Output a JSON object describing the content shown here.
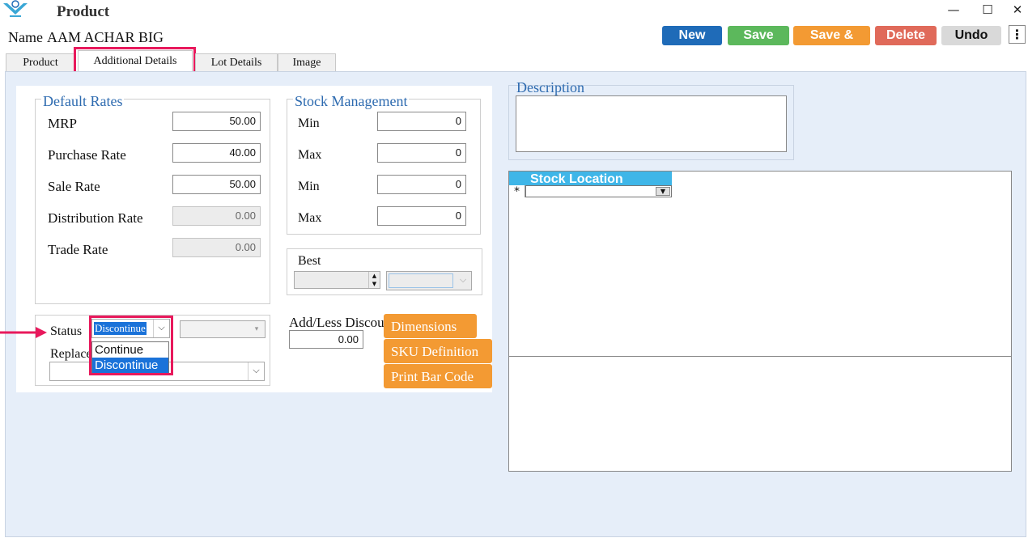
{
  "window": {
    "title": "Product",
    "minimize": "—",
    "maximize": "☐",
    "close": "✕"
  },
  "name": {
    "label": "Name",
    "value": "AAM ACHAR BIG"
  },
  "toolbar": {
    "new": "New",
    "save": "Save",
    "save_and": "Save &",
    "delete": "Delete",
    "undo": "Undo",
    "more": "⋮",
    "colors": {
      "new": "#1f6bb8",
      "save": "#5cb85c",
      "save_and": "#f39a33",
      "delete": "#e06a5a",
      "undo": "#d9d9d9"
    }
  },
  "tabs": [
    "Product",
    "Additional Details",
    "Lot Details",
    "Image"
  ],
  "default_rates": {
    "title": "Default Rates",
    "rows": [
      {
        "label": "MRP",
        "value": "50.00",
        "disabled": false
      },
      {
        "label": "Purchase Rate",
        "value": "40.00",
        "disabled": false
      },
      {
        "label": "Sale Rate",
        "value": "50.00",
        "disabled": false
      },
      {
        "label": "Distribution Rate",
        "value": "0.00",
        "disabled": true
      },
      {
        "label": "Trade Rate",
        "value": "0.00",
        "disabled": true
      }
    ]
  },
  "stock_management": {
    "title": "Stock Management",
    "rows": [
      {
        "label": "Min",
        "value": "0"
      },
      {
        "label": "Max",
        "value": "0"
      },
      {
        "label": "Min",
        "value": "0"
      },
      {
        "label": "Max",
        "value": "0"
      }
    ]
  },
  "best": {
    "label": "Best"
  },
  "status": {
    "label": "Status",
    "selected": "Discontinue",
    "options": [
      "Continue",
      "Discontinue"
    ],
    "replace_label": "Replace Product"
  },
  "add_less": {
    "label": "Add/Less Discount",
    "value": "0.00"
  },
  "actions": {
    "dimensions": "Dimensions",
    "sku": "SKU Definition",
    "barcode": "Print Bar Code"
  },
  "description": {
    "title": "Description"
  },
  "stock_location": {
    "header": "Stock Location",
    "new_row_marker": "*"
  }
}
